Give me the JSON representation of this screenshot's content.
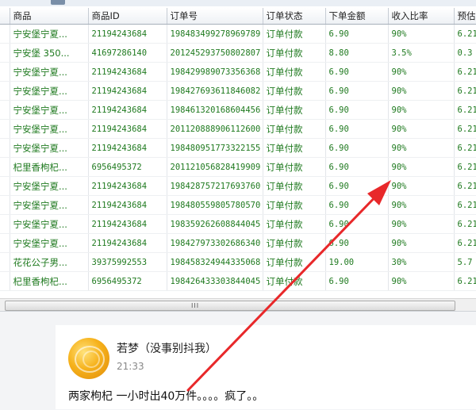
{
  "grid": {
    "columns": [
      "",
      "商品",
      "商品ID",
      "订单号",
      "订单状态",
      "下单金额",
      "收入比率",
      "预估"
    ],
    "rows": [
      [
        "宁安堡宁夏...",
        "21194243684",
        "198483499278969789",
        "订单付款",
        "6.90",
        "90%",
        "6.21"
      ],
      [
        "宁安堡 350...",
        "41697286140",
        "201245293750802807",
        "订单付款",
        "8.80",
        "3.5%",
        "0.3"
      ],
      [
        "宁安堡宁夏...",
        "21194243684",
        "198429989073356368",
        "订单付款",
        "6.90",
        "90%",
        "6.21"
      ],
      [
        "宁安堡宁夏...",
        "21194243684",
        "198427693611846082",
        "订单付款",
        "6.90",
        "90%",
        "6.21"
      ],
      [
        "宁安堡宁夏...",
        "21194243684",
        "198461320168604456",
        "订单付款",
        "6.90",
        "90%",
        "6.21"
      ],
      [
        "宁安堡宁夏...",
        "21194243684",
        "201120888906112600",
        "订单付款",
        "6.90",
        "90%",
        "6.21"
      ],
      [
        "宁安堡宁夏...",
        "21194243684",
        "198480951773322155",
        "订单付款",
        "6.90",
        "90%",
        "6.21"
      ],
      [
        "杞里香枸杞...",
        "6956495372",
        "201121056828419909",
        "订单付款",
        "6.90",
        "90%",
        "6.21"
      ],
      [
        "宁安堡宁夏...",
        "21194243684",
        "198428757217693760",
        "订单付款",
        "6.90",
        "90%",
        "6.21"
      ],
      [
        "宁安堡宁夏...",
        "21194243684",
        "198480559805780570",
        "订单付款",
        "6.90",
        "90%",
        "6.21"
      ],
      [
        "宁安堡宁夏...",
        "21194243684",
        "198359262608844045",
        "订单付款",
        "6.90",
        "90%",
        "6.21"
      ],
      [
        "宁安堡宁夏...",
        "21194243684",
        "198427973302686340",
        "订单付款",
        "6.90",
        "90%",
        "6.21"
      ],
      [
        "花花公子男...",
        "39375992553",
        "198458324944335068",
        "订单付款",
        "19.00",
        "30%",
        "5.7"
      ],
      [
        "杞里香枸杞...",
        "6956495372",
        "198426433303844045",
        "订单付款",
        "6.90",
        "90%",
        "6.21"
      ]
    ],
    "scroll_grip": "III"
  },
  "chat": {
    "username": "若梦（没事别抖我）",
    "time": "21:33",
    "message": "两家枸杞 一小时出40万件。。。。疯了。。"
  },
  "colors": {
    "cell_text": "#1f7a1f",
    "arrow": "#e8282a"
  }
}
